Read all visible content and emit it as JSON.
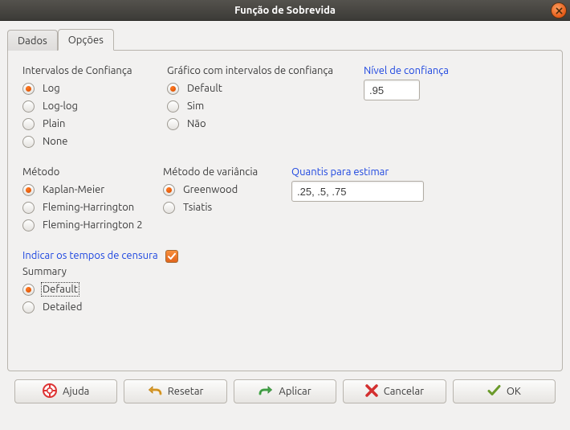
{
  "window": {
    "title": "Função de Sobrevida"
  },
  "tabs": {
    "dados": "Dados",
    "opcoes": "Opções"
  },
  "sections": {
    "conf_int": {
      "label": "Intervalos de Confiança",
      "options": {
        "log": "Log",
        "loglog": "Log-log",
        "plain": "Plain",
        "none": "None"
      }
    },
    "conf_plot": {
      "label": "Gráfico com intervalos de confiança",
      "options": {
        "default": "Default",
        "sim": "Sim",
        "nao": "Não"
      }
    },
    "conf_level": {
      "label": "Nível de confiança",
      "value": ".95"
    },
    "method": {
      "label": "Método",
      "options": {
        "km": "Kaplan-Meier",
        "fh": "Fleming-Harrington",
        "fh2": "Fleming-Harrington 2"
      }
    },
    "var_method": {
      "label": "Método de variância",
      "options": {
        "greenwood": "Greenwood",
        "tsiatis": "Tsiatis"
      }
    },
    "quantiles": {
      "label": "Quantis para estimar",
      "value": ".25, .5, .75"
    },
    "censor": {
      "label": "Indicar os tempos de censura"
    },
    "summary": {
      "label": "Summary",
      "options": {
        "default": "Default",
        "detailed": "Detailed"
      }
    }
  },
  "buttons": {
    "help": "Ajuda",
    "reset": "Resetar",
    "apply": "Aplicar",
    "cancel": "Cancelar",
    "ok": "OK"
  }
}
